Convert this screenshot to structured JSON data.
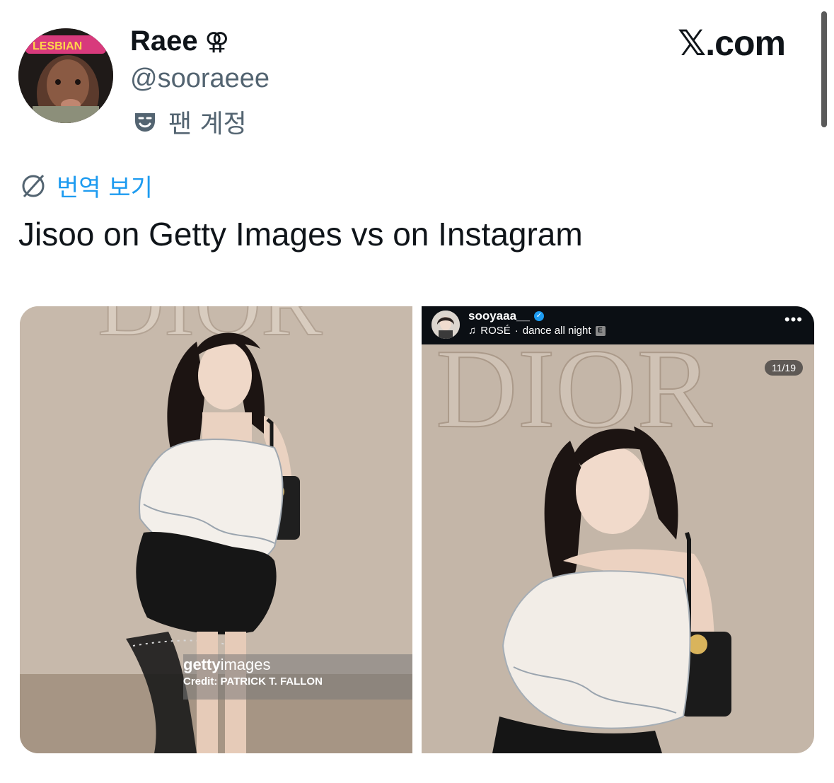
{
  "brand": "𝕏.com",
  "author": {
    "display_name": "Raee",
    "gender_symbol": "⚢",
    "handle": "@sooraeee",
    "account_type": "팬 계정",
    "avatar_hat_text": "LESBIAN"
  },
  "translate_label": "번역 보기",
  "tweet_text": "Jisoo on Getty Images vs on Instagram",
  "left_photo": {
    "watermark_brand_light_prefix": "getty",
    "watermark_brand_suffix": "images",
    "watermark_credit": "Credit: PATRICK T. FALLON",
    "backdrop_text": "DIOR"
  },
  "right_photo": {
    "username": "sooyaaa__",
    "music_artist": "ROSÉ",
    "music_separator": "·",
    "music_title": "dance all night",
    "explicit_badge": "E",
    "more_glyph": "•••",
    "counter": "11/19"
  },
  "colors": {
    "link_blue": "#1d9bf0",
    "muted_text": "#536471",
    "wall": "#cdbfb1"
  }
}
